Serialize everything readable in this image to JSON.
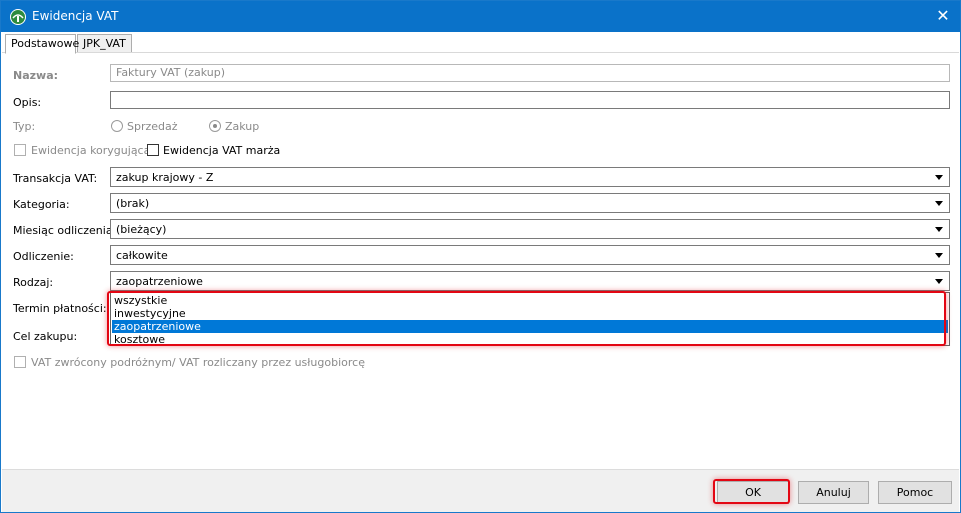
{
  "window": {
    "title": "Ewidencja VAT",
    "close_glyph": "✕",
    "accent_color": "#0a72c9"
  },
  "tabs": [
    {
      "label": "Podstawowe",
      "active": true
    },
    {
      "label": "JPK_VAT",
      "active": false
    }
  ],
  "form": {
    "nazwa": {
      "label": "Nazwa:",
      "value": "Faktury VAT (zakup)"
    },
    "opis": {
      "label": "Opis:",
      "value": ""
    },
    "typ": {
      "label": "Typ:",
      "options": [
        "Sprzedaż",
        "Zakup"
      ],
      "selected": "Zakup"
    },
    "ewidencja_korygujaca": {
      "label": "Ewidencja korygująca",
      "checked": false
    },
    "ewidencja_vat_marza": {
      "label": "Ewidencja VAT marża",
      "checked": false
    },
    "transakcja_vat": {
      "label": "Transakcja VAT:",
      "value": "zakup krajowy - Z"
    },
    "kategoria": {
      "label": "Kategoria:",
      "value": "(brak)"
    },
    "miesiac_odliczenia": {
      "label": "Miesiąc odliczenia:",
      "value": "(bieżący)"
    },
    "odliczenie": {
      "label": "Odliczenie:",
      "value": "całkowite"
    },
    "rodzaj": {
      "label": "Rodzaj:",
      "value": "zaopatrzeniowe"
    },
    "termin_platnosci": {
      "label": "Termin płatności:"
    },
    "cel_zakupu": {
      "label": "Cel zakupu:"
    },
    "vat_zwrocony": {
      "label": "VAT zwrócony podróżnym/ VAT rozliczany przez usługobiorcę",
      "checked": false
    }
  },
  "dropdown": {
    "options": [
      "wszystkie",
      "inwestycyjne",
      "zaopatrzeniowe",
      "kosztowe"
    ],
    "selected": "zaopatrzeniowe",
    "highlight_color": "#e30613",
    "selection_color": "#0078d7"
  },
  "buttons": {
    "ok": "OK",
    "anuluj": "Anuluj",
    "pomoc": "Pomoc"
  }
}
